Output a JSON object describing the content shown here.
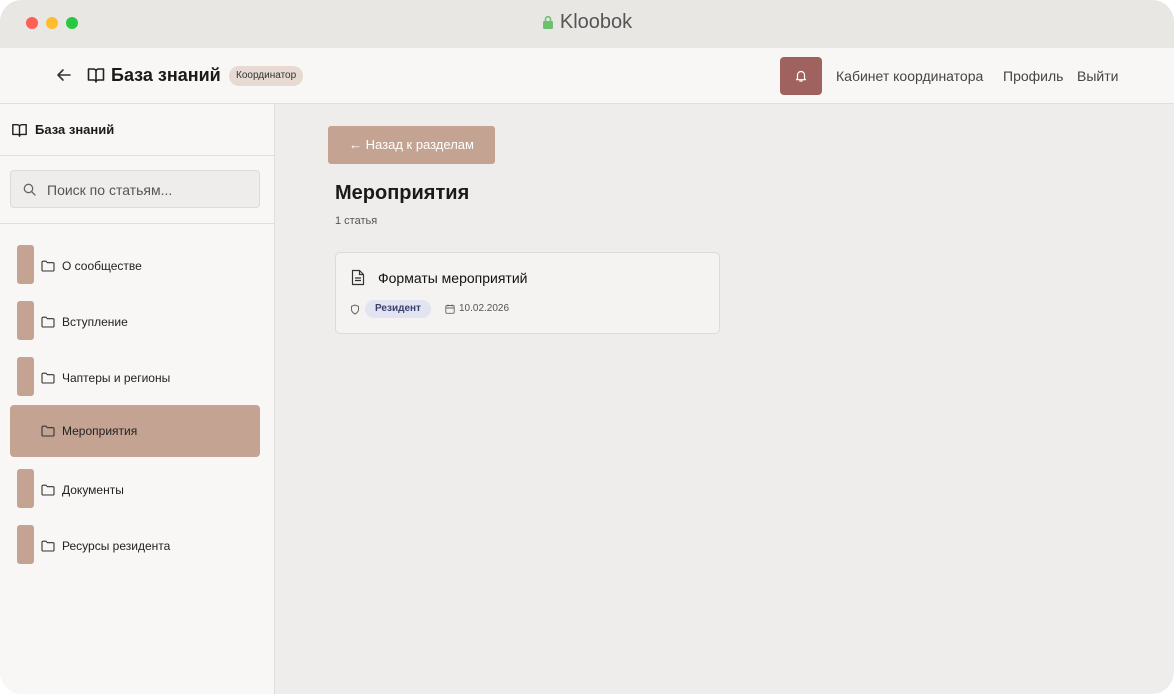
{
  "window": {
    "title": "Kloobok",
    "lock_icon": "lock-icon"
  },
  "header": {
    "title": "База знаний",
    "role_badge": "Координатор",
    "links": {
      "cabinet": "Кабинет координатора",
      "profile": "Профиль",
      "logout": "Выйти"
    },
    "colors": {
      "bell_button": "#a0625f"
    }
  },
  "sidebar": {
    "title": "База знаний",
    "search": {
      "placeholder": "Поиск по статьям...",
      "value": ""
    },
    "items": [
      {
        "label": "О сообществе",
        "active": false
      },
      {
        "label": "Вступление",
        "active": false
      },
      {
        "label": "Чаптеры и регионы",
        "active": false
      },
      {
        "label": "Мероприятия",
        "active": true
      },
      {
        "label": "Документы",
        "active": false
      },
      {
        "label": "Ресурсы резидента",
        "active": false
      }
    ],
    "colors": {
      "accent": "#c4a392"
    }
  },
  "main": {
    "back_button": "← Назад к разделам",
    "section_title": "Мероприятия",
    "count": "1 статья",
    "articles": [
      {
        "title": "Форматы мероприятий",
        "access": "Резидент",
        "date": "10.02.2026"
      }
    ]
  }
}
